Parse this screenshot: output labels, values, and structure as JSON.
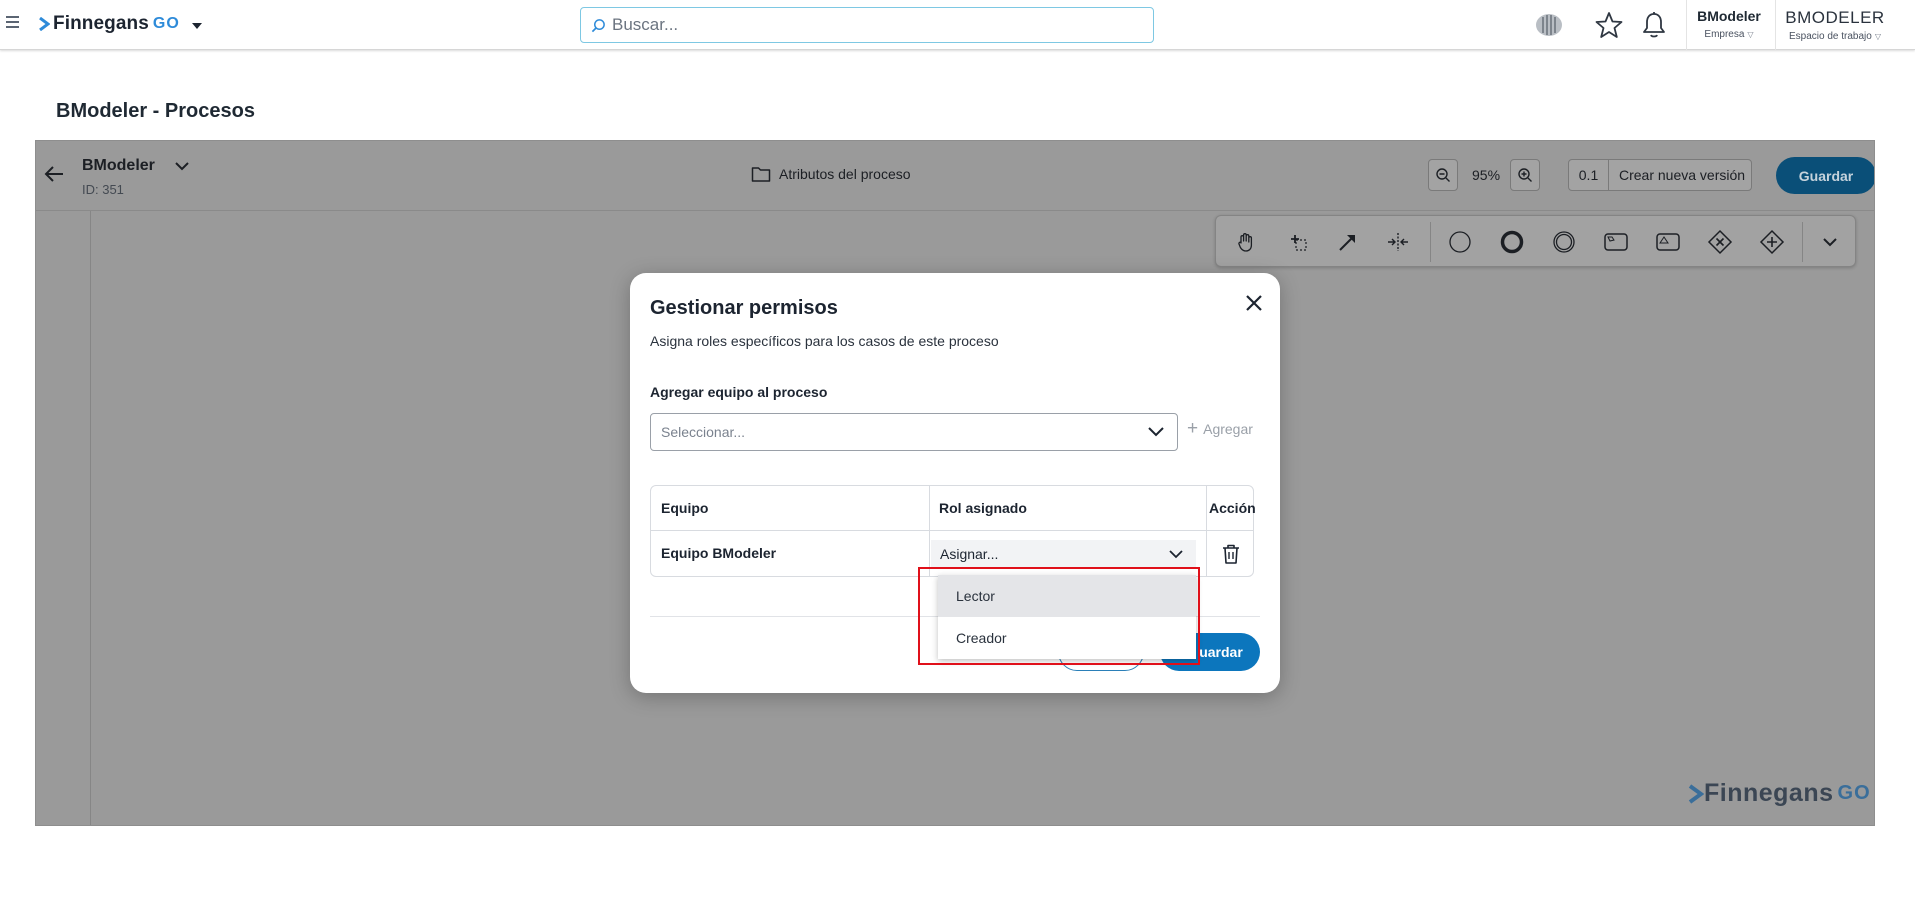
{
  "topbar": {
    "logo_text": "Finnegans",
    "logo_go": "GO",
    "search_placeholder": "Buscar...",
    "company_name": "BModeler",
    "company_label": "Empresa",
    "workspace_name": "BMODELER",
    "workspace_label": "Espacio de trabajo",
    "icons": [
      "menu-icon",
      "brain-icon",
      "star-icon",
      "bell-icon"
    ]
  },
  "page": {
    "title": "BModeler - Procesos"
  },
  "editor": {
    "process_name": "BModeler",
    "process_id": "ID: 351",
    "attributes_link": "Atributos del proceso",
    "zoom": "95%",
    "version_number": "0.1",
    "new_version_label": "Crear nueva versión",
    "save_label": "Guardar",
    "tools": [
      "hand-tool-icon",
      "lasso-tool-icon",
      "connect-tool-icon",
      "space-tool-icon",
      "start-event-icon",
      "end-event-icon",
      "intermediate-event-icon",
      "task-icon",
      "subprocess-icon",
      "exclusive-gateway-icon",
      "parallel-gateway-icon",
      "more-tools-icon"
    ],
    "watermark_text": "Finnegans",
    "watermark_go": "GO"
  },
  "modal": {
    "title": "Gestionar permisos",
    "subtitle": "Asigna roles específicos para los casos de este proceso",
    "add_team_label": "Agregar equipo al proceso",
    "team_select_placeholder": "Seleccionar...",
    "add_button": "Agregar",
    "table": {
      "headers": [
        "Equipo",
        "Rol asignado",
        "Acción"
      ],
      "rows": [
        {
          "team": "Equipo BModeler",
          "role": "Asignar..."
        }
      ]
    },
    "cancel_label": "",
    "save_label": "Guardar",
    "save_visible": "uardar"
  },
  "dropdown": {
    "options": [
      "Lector",
      "Creador"
    ],
    "hovered": "Lector"
  },
  "colors": {
    "accent": "#0c76bd",
    "highlight": "#e0101a",
    "overlay": "#9a9a9a"
  }
}
